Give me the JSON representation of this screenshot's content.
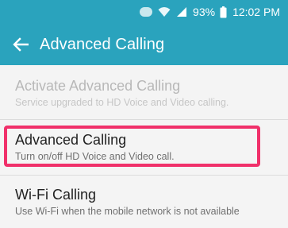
{
  "status_bar": {
    "battery": "93%",
    "time": "12:02 PM",
    "icons": [
      "message-icon",
      "wifi-icon",
      "signal-icon",
      "battery-icon"
    ]
  },
  "app_bar": {
    "back_icon": "arrow-left-icon",
    "title": "Advanced Calling"
  },
  "settings": [
    {
      "title": "Activate Advanced Calling",
      "subtitle": "Service upgraded to HD Voice and Video calling.",
      "enabled": false
    },
    {
      "title": "Advanced Calling",
      "subtitle": "Turn on/off HD Voice and Video call.",
      "enabled": true
    },
    {
      "title": "Wi-Fi Calling",
      "subtitle": "Use Wi-Fi when the mobile network is not available",
      "enabled": true
    }
  ],
  "colors": {
    "accent": "#2aa3bd",
    "highlight_border": "#f0306a",
    "background": "#f4f4f4"
  }
}
